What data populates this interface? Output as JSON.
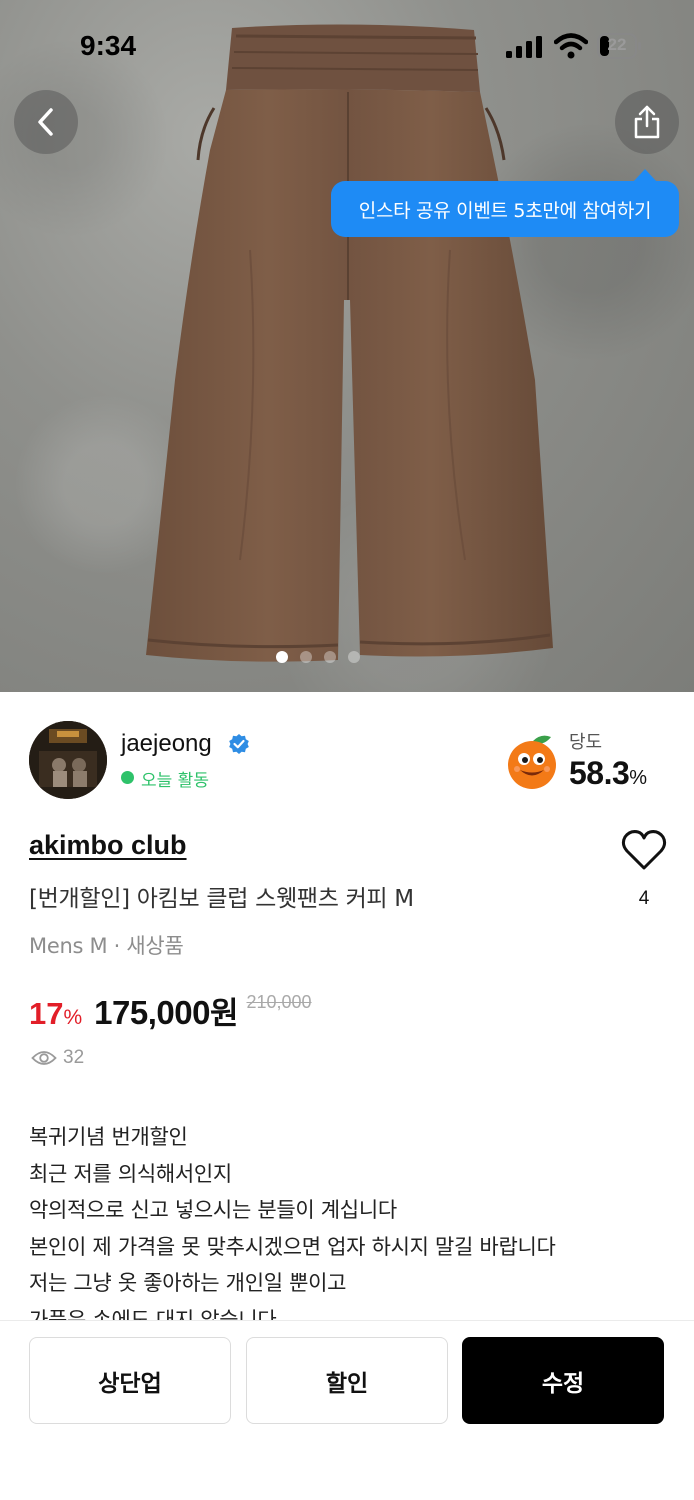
{
  "status_bar": {
    "time": "9:34",
    "battery": "22"
  },
  "hero": {
    "tooltip": "인스타 공유 이벤트 5초만에 참여하기",
    "image_count": 4,
    "current_image": 1,
    "product_color": "#7a5a45"
  },
  "seller": {
    "name": "jaejeong",
    "status": "오늘 활동",
    "sweetness_label": "당도",
    "sweetness_value": "58.3",
    "sweetness_unit": "%"
  },
  "product": {
    "brand": "akimbo club",
    "title": "[번개할인] 아킴보 클럽 스웻팬츠 커피 M",
    "likes": "4",
    "meta": "Mens M · 새상품",
    "discount_percent": "17",
    "discount_unit": "%",
    "price": "175,000",
    "price_unit": "원",
    "original_price": "210,000",
    "views": "32"
  },
  "description": [
    "복귀기념 번개할인",
    "최근 저를 의식해서인지",
    "악의적으로 신고 넣으시는 분들이 계십니다",
    "본인이 제 가격을 못 맞추시겠으면 업자 하시지 말길 바랍니다",
    "저는 그냥 옷 좋아하는 개인일 뿐이고",
    "가품은 손에도 대지 않습니다"
  ],
  "actions": {
    "bump": "상단업",
    "discount": "할인",
    "edit": "수정"
  },
  "colors": {
    "accent_blue": "#1e8bf5",
    "online_green": "#2ec26a",
    "discount_red": "#e21e28"
  }
}
